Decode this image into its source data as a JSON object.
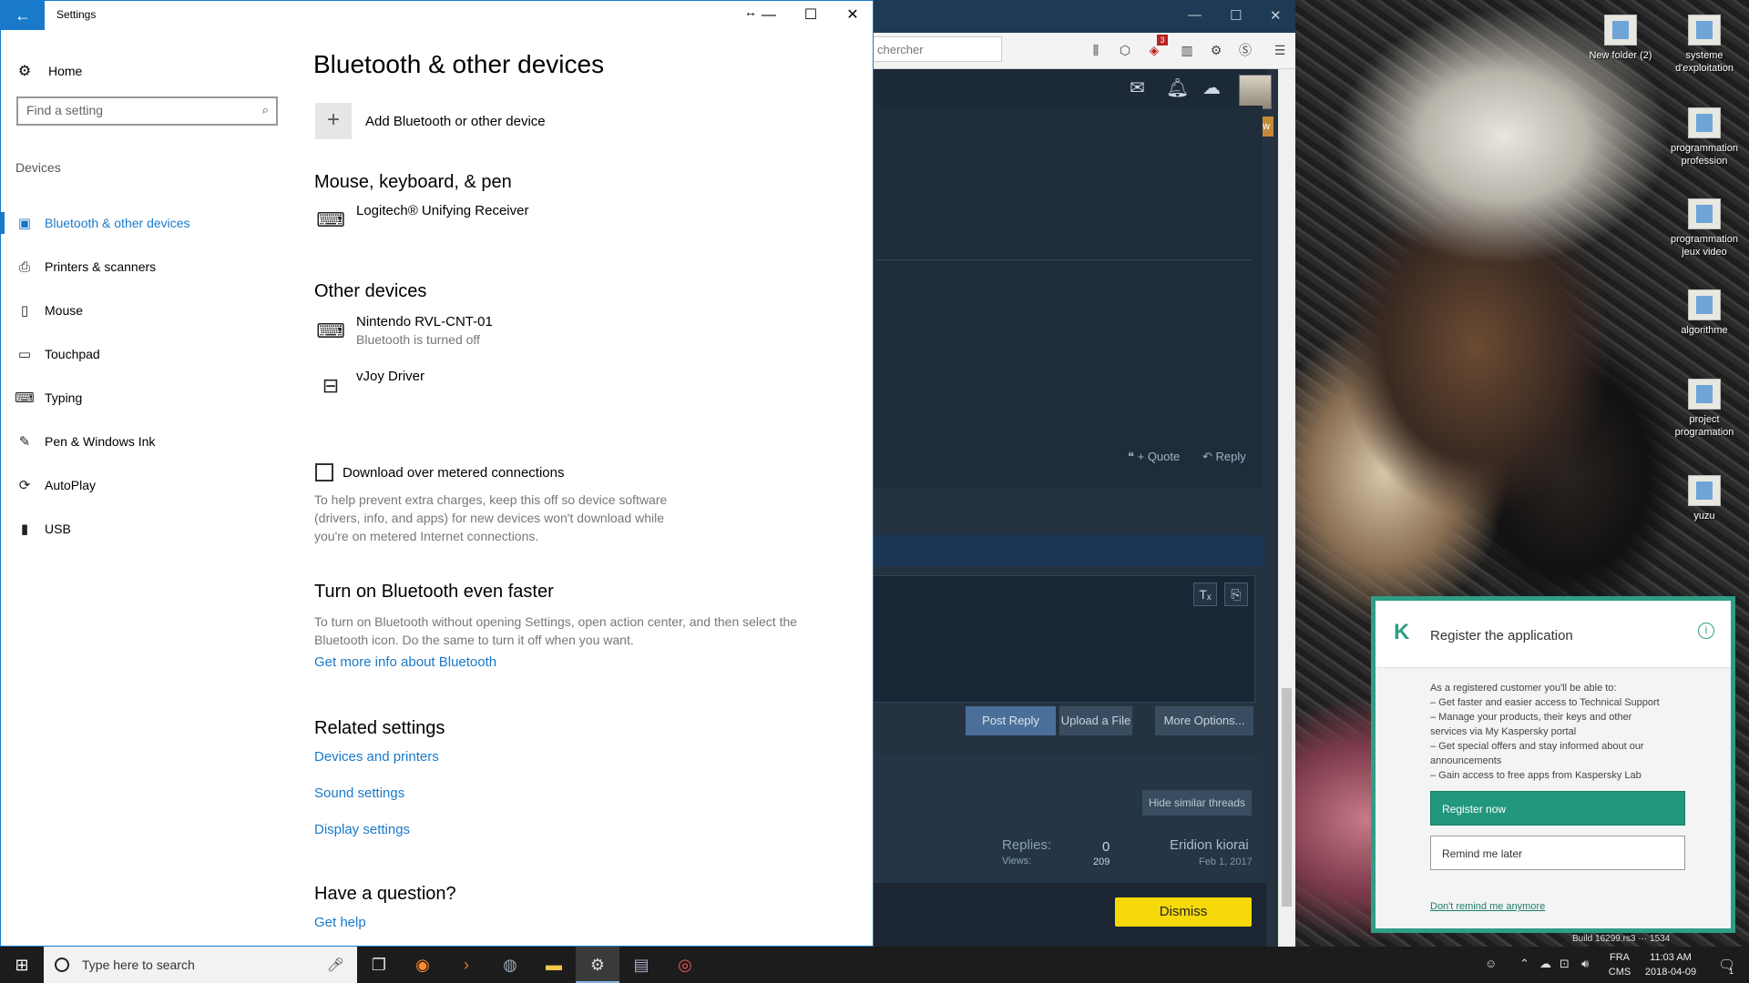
{
  "settings": {
    "window_title": "Settings",
    "back_glyph": "←",
    "home": "Home",
    "search_placeholder": "Find a setting",
    "section": "Devices",
    "nav_items": [
      {
        "label": "Bluetooth & other devices",
        "icon": "bluetooth-devices-icon",
        "glyph": "▣",
        "active": true
      },
      {
        "label": "Printers & scanners",
        "icon": "printer-icon",
        "glyph": "⎙"
      },
      {
        "label": "Mouse",
        "icon": "mouse-icon",
        "glyph": "▯"
      },
      {
        "label": "Touchpad",
        "icon": "touchpad-icon",
        "glyph": "▭"
      },
      {
        "label": "Typing",
        "icon": "keyboard-icon",
        "glyph": "⌨"
      },
      {
        "label": "Pen & Windows Ink",
        "icon": "pen-icon",
        "glyph": "✎"
      },
      {
        "label": "AutoPlay",
        "icon": "autoplay-icon",
        "glyph": "⟳"
      },
      {
        "label": "USB",
        "icon": "usb-icon",
        "glyph": "▮"
      }
    ],
    "page_title": "Bluetooth & other devices",
    "add_device_label": "Add Bluetooth or other device",
    "sections": {
      "mouse_keyboard": "Mouse, keyboard, & pen",
      "other_devices": "Other devices",
      "faster": "Turn on Bluetooth even faster",
      "related": "Related settings",
      "question": "Have a question?"
    },
    "devices": {
      "logitech": {
        "name": "Logitech® Unifying Receiver"
      },
      "nintendo": {
        "name": "Nintendo RVL-CNT-01",
        "status": "Bluetooth is turned off"
      },
      "vjoy": {
        "name": "vJoy Driver"
      }
    },
    "metered_label": "Download over metered connections",
    "metered_desc": [
      "To help prevent extra charges, keep this off so device software",
      "(drivers, info, and apps) for new devices won't download while",
      "you're on metered Internet connections."
    ],
    "faster_desc": [
      "To turn on Bluetooth without opening Settings, open action center, and then select the",
      "Bluetooth icon. Do the same to turn it off when you want."
    ],
    "faster_link": "Get more info about Bluetooth",
    "related_links": [
      "Devices and printers",
      "Sound settings",
      "Display settings"
    ],
    "help_link": "Get help"
  },
  "browser": {
    "search_placeholder": "chercher",
    "new_badge": "New",
    "quote_label": "+ Quote",
    "reply_label": "Reply",
    "post_reply": "Post Reply",
    "upload_file": "Upload a File",
    "more_options": "More Options...",
    "hide_similar": "Hide similar threads",
    "replies_label": "Replies:",
    "replies_value": "0",
    "views_label": "Views:",
    "views_value": "209",
    "author": "Eridion kiorai",
    "date": "Feb 1, 2017",
    "dismiss": "Dismiss",
    "notification_count": "3"
  },
  "kaspersky": {
    "title": "Register the application",
    "body_lines": [
      "As a registered customer you'll be able to:",
      "– Get faster and easier access to Technical Support",
      "– Manage your products, their keys and other",
      "services via My Kaspersky portal",
      "– Get special offers and stay informed about our",
      "announcements",
      "– Gain access to free apps from Kaspersky Lab"
    ],
    "register_btn": "Register now",
    "remind_btn": "Remind me later",
    "dont_remind": "Don't remind me anymore",
    "accent": "#21977d"
  },
  "desktop": {
    "icons": [
      {
        "label": "New folder (2)"
      },
      {
        "label": "systeme d'exploitation"
      },
      {
        "label": "programmation profession"
      },
      {
        "label": "programmation jeux video"
      },
      {
        "label": "algorithme"
      },
      {
        "label": "project programation"
      },
      {
        "label": "yuzu"
      }
    ],
    "build": "Build 16299.rs3",
    "build_tail": "1534"
  },
  "taskbar": {
    "search_placeholder": "Type here to search",
    "lang": "FRA",
    "ime": "CMS",
    "time": "11:03 AM",
    "date": "2018-04-09",
    "notification_count": "1"
  },
  "colors": {
    "accent": "#1979ca",
    "dismiss": "#f5d90a"
  }
}
